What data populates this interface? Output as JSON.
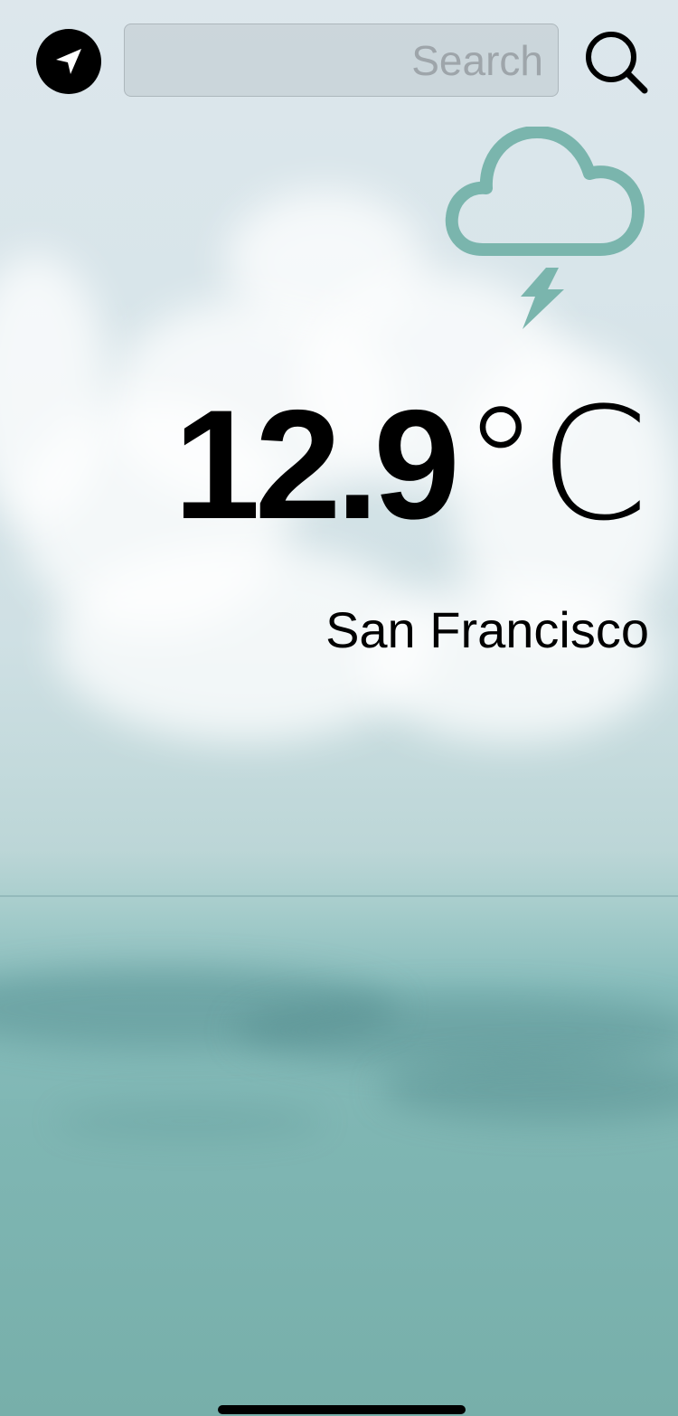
{
  "header": {
    "location_button_icon": "location-arrow-icon",
    "search": {
      "value": "",
      "placeholder": "Search"
    },
    "search_button_icon": "magnifying-glass-icon"
  },
  "weather": {
    "condition_icon": "cloud-bolt-icon",
    "condition_icon_color": "#7ab5ad",
    "temperature_value": "12.9",
    "temperature_unit": "°C",
    "city": "San Francisco"
  },
  "colors": {
    "text": "#000000",
    "search_field_bg": "#c3cbcf",
    "sky_top": "#dde7ec",
    "sea": "#7fb6b3"
  }
}
